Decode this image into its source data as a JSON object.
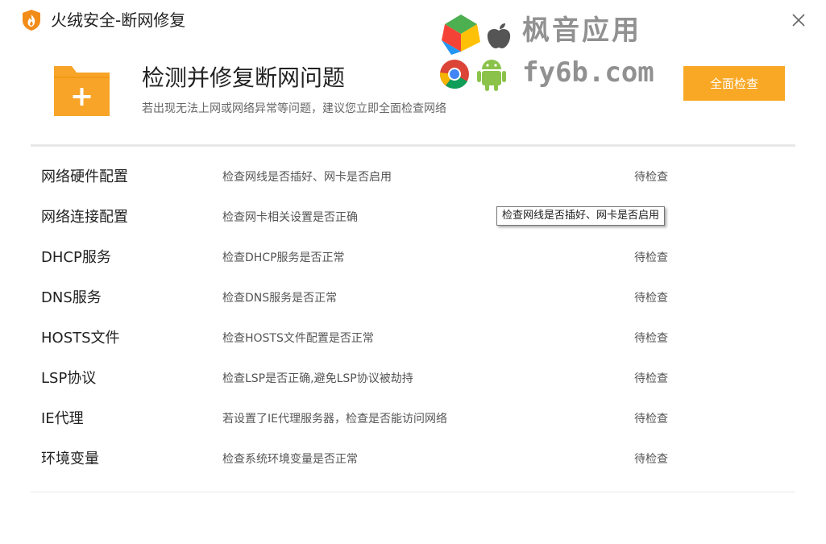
{
  "window": {
    "title": "火绒安全-断网修复",
    "close_icon": "close-icon",
    "logo_icon": "flame-shield-icon"
  },
  "watermark": {
    "line1": "枫音应用",
    "line2": "fy6b.com",
    "icons": [
      "windows-logo-icon",
      "apple-logo-icon",
      "chrome-logo-icon",
      "android-logo-icon"
    ]
  },
  "header": {
    "icon": "folder-plus-icon",
    "title": "检测并修复断网问题",
    "subtitle": "若出现无法上网或网络异常等问题，建议您立即全面检查网络",
    "button_label": "全面检查"
  },
  "items": [
    {
      "name": "网络硬件配置",
      "desc": "检查网线是否插好、网卡是否启用",
      "status": "待检查"
    },
    {
      "name": "网络连接配置",
      "desc": "检查网卡相关设置是否正确",
      "status": ""
    },
    {
      "name": "DHCP服务",
      "desc": "检查DHCP服务是否正常",
      "status": "待检查"
    },
    {
      "name": "DNS服务",
      "desc": "检查DNS服务是否正常",
      "status": "待检查"
    },
    {
      "name": "HOSTS文件",
      "desc": "检查HOSTS文件配置是否正常",
      "status": "待检查"
    },
    {
      "name": "LSP协议",
      "desc": "检查LSP是否正确,避免LSP协议被劫持",
      "status": "待检查"
    },
    {
      "name": "IE代理",
      "desc": "若设置了IE代理服务器，检查是否能访问网络",
      "status": "待检查"
    },
    {
      "name": "环境变量",
      "desc": "检查系统环境变量是否正常",
      "status": "待检查"
    }
  ],
  "tooltip": {
    "text": "检查网线是否插好、网卡是否启用"
  },
  "colors": {
    "accent": "#f9a825",
    "folder": "#f7a428",
    "divider": "#e8e8e8"
  }
}
